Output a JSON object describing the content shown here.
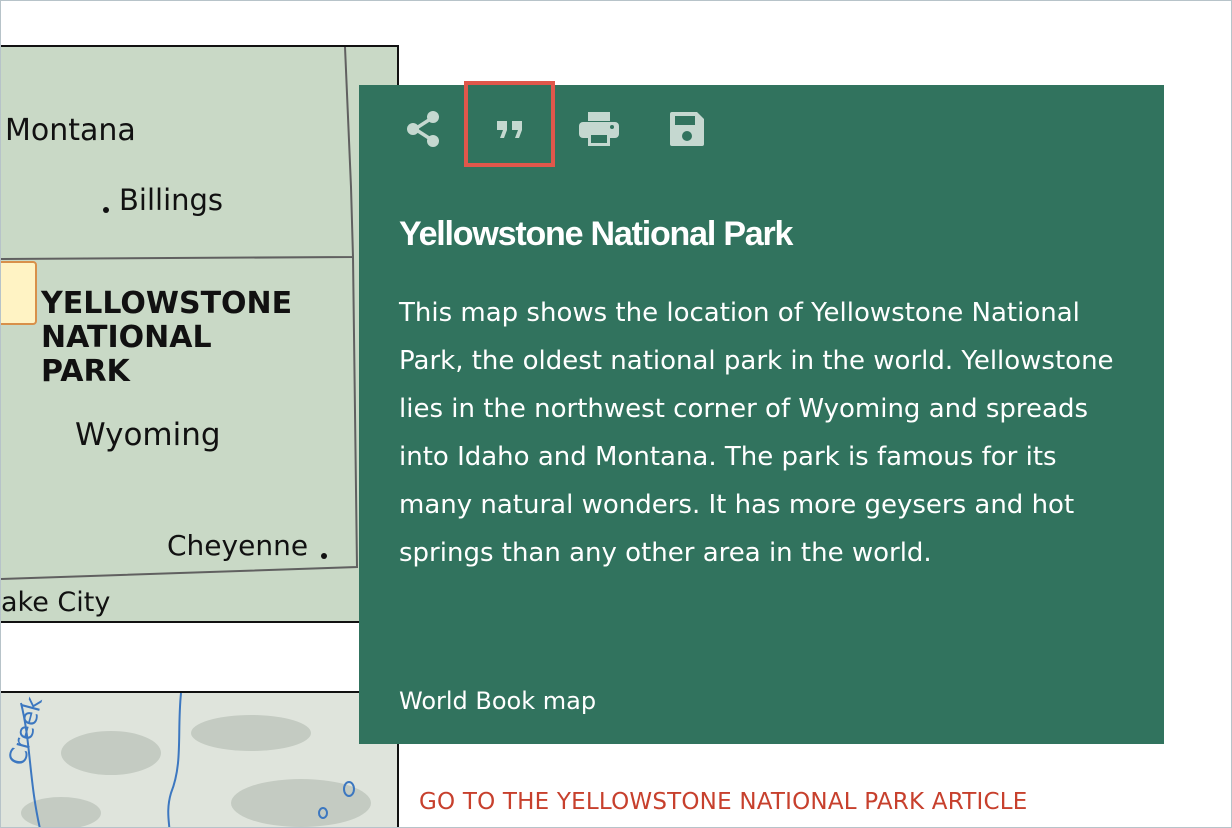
{
  "map": {
    "labels": {
      "montana": "Montana",
      "billings": "Billings",
      "park_line1": "YELLOWSTONE",
      "park_line2": "NATIONAL",
      "park_line3": "PARK",
      "wyoming": "Wyoming",
      "cheyenne": "Cheyenne",
      "lake_city": "ake City",
      "creek": "Creek"
    },
    "colors": {
      "land": "#c9d9c6",
      "park": "#fff3c4",
      "water": "#3c77c0"
    }
  },
  "popover": {
    "toolbar": [
      {
        "name": "share",
        "icon": "share-icon"
      },
      {
        "name": "cite",
        "icon": "quote-icon",
        "highlighted": true
      },
      {
        "name": "print",
        "icon": "print-icon"
      },
      {
        "name": "save",
        "icon": "save-icon"
      }
    ],
    "title": "Yellowstone National Park",
    "description": "This map shows the location of Yellowstone National Park, the oldest national park in the world. Yellowstone lies in the northwest corner of Wyoming and spreads into Idaho and Montana. The park is famous for its many natural wonders. It has more geysers and hot springs than any other area in the world.",
    "credit": "World Book map",
    "colors": {
      "background": "#31735e",
      "icon": "#c5d8d0",
      "highlight": "#e0574b"
    }
  },
  "article_link": {
    "label": "GO TO THE YELLOWSTONE NATIONAL PARK ARTICLE",
    "color": "#c7402d"
  }
}
